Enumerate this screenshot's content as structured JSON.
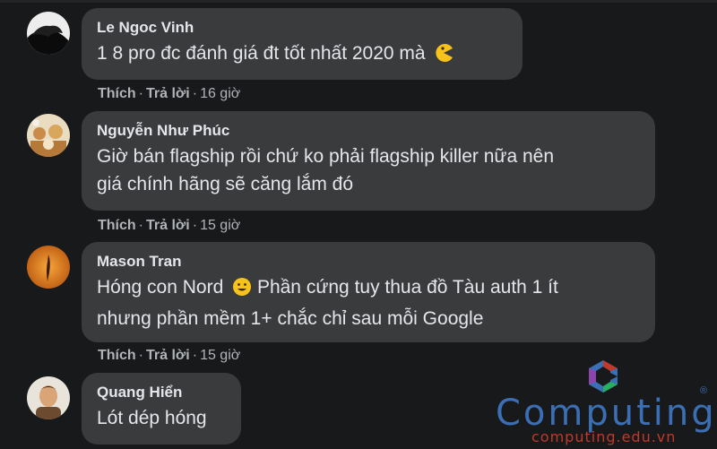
{
  "comments": [
    {
      "author": "Le Ngoc Vinh",
      "text": "1 8 pro đc đánh giá đt tốt nhất 2020 mà",
      "emoji": "pacman-emoji",
      "actions": {
        "like": "Thích",
        "reply": "Trả lời",
        "time": "16 giờ"
      }
    },
    {
      "author": "Nguyễn Như Phúc",
      "lines": [
        "Giờ bán flagship rồi chứ ko phải flagship killer nữa nên",
        "giá chính hãng sẽ căng lắm đó"
      ],
      "actions": {
        "like": "Thích",
        "reply": "Trả lời",
        "time": "15 giờ"
      }
    },
    {
      "author": "Mason Tran",
      "lines": [
        "Hóng con Nord",
        "Phần cứng tuy thua đồ Tàu auth 1 ít",
        "nhưng phần mềm 1+ chắc chỉ sau mỗi Google"
      ],
      "emoji": "smile-emoji",
      "actions": {
        "like": "Thích",
        "reply": "Trả lời",
        "time": "15 giờ"
      }
    },
    {
      "author": "Quang Hiển",
      "text": "Lót dép hóng"
    }
  ],
  "separator": "·",
  "watermark": {
    "brand": "Computing",
    "url": "computing.edu.vn",
    "registered": "®"
  },
  "colors": {
    "background": "#18191a",
    "bubble": "#3a3b3c",
    "text": "#e4e6eb",
    "meta": "#b0b3b8",
    "brand_blue": "#3b6fb5",
    "brand_red": "#c0392b"
  }
}
